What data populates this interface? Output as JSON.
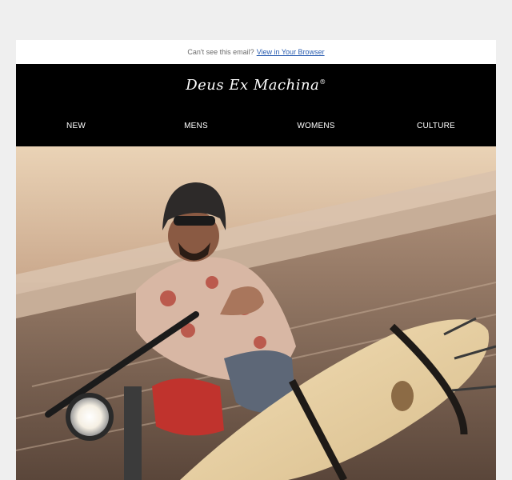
{
  "preheader": {
    "text": "Can't see this email?",
    "link": "View in Your Browser"
  },
  "brand": {
    "logo_text": "Deus Ex Machina",
    "registered_mark": "®"
  },
  "nav": {
    "items": [
      {
        "label": "NEW"
      },
      {
        "label": "MENS"
      },
      {
        "label": "WOMENS"
      },
      {
        "label": "CULTURE"
      }
    ]
  },
  "hero": {
    "description_icon": "motorcycle-surfboard-photo"
  },
  "colors": {
    "page_bg": "#efefef",
    "header_bg": "#000000",
    "link": "#2a5db0"
  }
}
